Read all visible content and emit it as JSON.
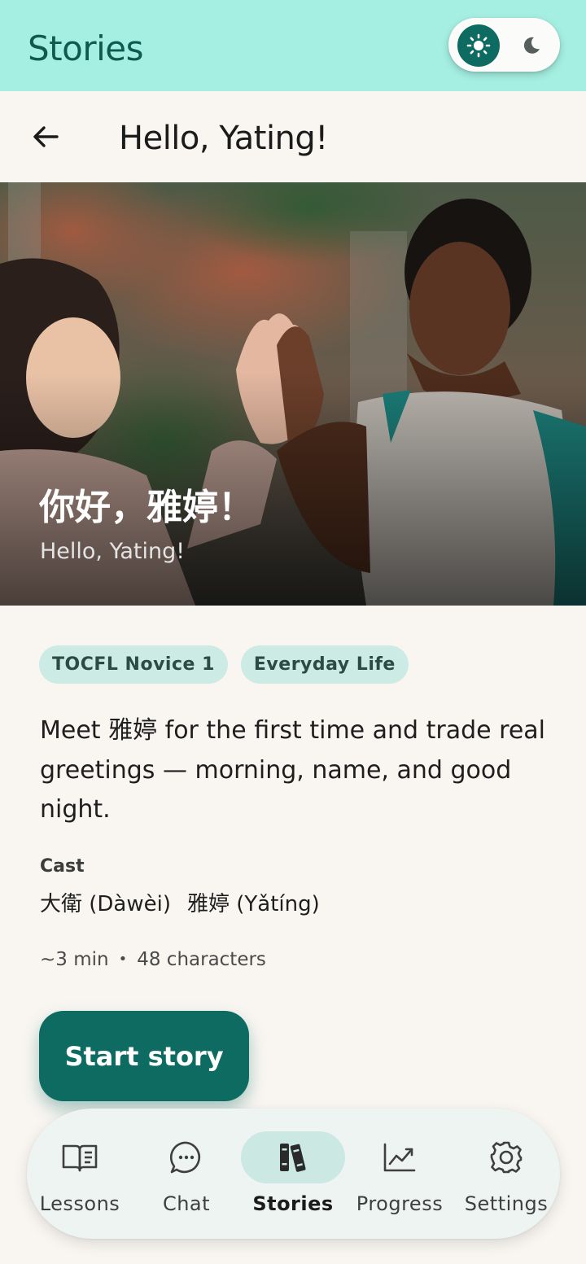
{
  "app_bar": {
    "title": "Stories",
    "theme_toggle": {
      "selected": "light",
      "options": [
        "sun-icon",
        "moon-icon"
      ]
    }
  },
  "header": {
    "back_icon": "arrow-left-icon",
    "title": "Hello, Yating!"
  },
  "hero": {
    "title": "你好，雅婷！",
    "subtitle": "Hello, Yating!"
  },
  "tags": [
    "TOCFL Novice 1",
    "Everyday Life"
  ],
  "description": "Meet 雅婷 for the first time and trade real greetings — morning, name, and good night.",
  "cast": {
    "label": "Cast",
    "members": [
      "大衛 (Dàwèi)",
      "雅婷 (Yǎtíng)"
    ]
  },
  "meta": {
    "duration": "~3 min",
    "separator": "•",
    "characters": "48 characters"
  },
  "start_button": {
    "label": "Start story"
  },
  "bottom_nav": {
    "items": [
      {
        "label": "Lessons",
        "icon": "book-open-icon",
        "active": false
      },
      {
        "label": "Chat",
        "icon": "chat-bubble-icon",
        "active": false
      },
      {
        "label": "Stories",
        "icon": "books-icon",
        "active": true
      },
      {
        "label": "Progress",
        "icon": "trend-chart-icon",
        "active": false
      },
      {
        "label": "Settings",
        "icon": "gear-icon",
        "active": false
      }
    ]
  },
  "colors": {
    "app_bar": "#a5efe2",
    "accent": "#0d6b61",
    "tag_bg": "#cdebe5",
    "background": "#f9f6f2"
  }
}
